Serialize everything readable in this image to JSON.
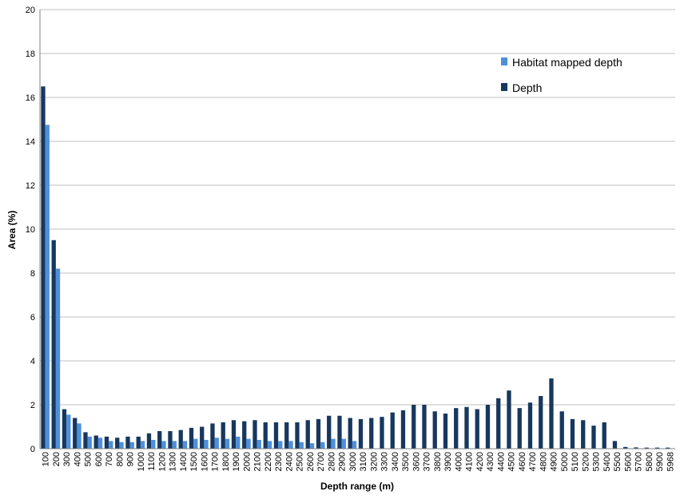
{
  "chart_data": {
    "type": "bar",
    "title": "",
    "xlabel": "Depth range (m)",
    "ylabel": "Area (%)",
    "ylim": [
      0,
      20
    ],
    "yticks": [
      0,
      2,
      4,
      6,
      8,
      10,
      12,
      14,
      16,
      18,
      20
    ],
    "grid": "horizontal",
    "legend_position": "top-right",
    "categories": [
      "100",
      "200",
      "300",
      "400",
      "500",
      "600",
      "700",
      "800",
      "900",
      "1000",
      "1100",
      "1200",
      "1300",
      "1400",
      "1500",
      "1600",
      "1700",
      "1800",
      "1900",
      "2000",
      "2100",
      "2200",
      "2300",
      "2400",
      "2500",
      "2600",
      "2700",
      "2800",
      "2900",
      "3000",
      "3100",
      "3200",
      "3300",
      "3400",
      "3500",
      "3600",
      "3700",
      "3800",
      "3900",
      "4000",
      "4100",
      "4200",
      "4300",
      "4400",
      "4500",
      "4600",
      "4700",
      "4800",
      "4900",
      "5000",
      "5100",
      "5200",
      "5300",
      "5400",
      "5500",
      "5600",
      "5700",
      "5800",
      "5900",
      "5968"
    ],
    "series": [
      {
        "name": "Depth",
        "color": "#17375e",
        "values": [
          16.5,
          9.5,
          1.8,
          1.4,
          0.75,
          0.6,
          0.55,
          0.5,
          0.55,
          0.55,
          0.7,
          0.8,
          0.8,
          0.85,
          0.95,
          1.0,
          1.15,
          1.2,
          1.3,
          1.25,
          1.3,
          1.2,
          1.2,
          1.2,
          1.2,
          1.3,
          1.35,
          1.5,
          1.5,
          1.4,
          1.35,
          1.4,
          1.45,
          1.65,
          1.75,
          2.0,
          2.0,
          1.7,
          1.6,
          1.85,
          1.9,
          1.8,
          2.0,
          2.3,
          2.65,
          1.85,
          2.1,
          2.4,
          3.2,
          1.7,
          1.35,
          1.3,
          1.05,
          1.2,
          0.35,
          0.08,
          0.06,
          0.05,
          0.05,
          0.05
        ]
      },
      {
        "name": "Habitat mapped depth",
        "color": "#4f8fd9",
        "values": [
          14.75,
          8.2,
          1.55,
          1.15,
          0.55,
          0.5,
          0.35,
          0.3,
          0.3,
          0.35,
          0.4,
          0.35,
          0.35,
          0.35,
          0.45,
          0.4,
          0.5,
          0.45,
          0.55,
          0.45,
          0.4,
          0.35,
          0.35,
          0.35,
          0.3,
          0.25,
          0.3,
          0.45,
          0.45,
          0.35,
          null,
          null,
          null,
          null,
          null,
          null,
          null,
          null,
          null,
          null,
          null,
          null,
          null,
          null,
          null,
          null,
          null,
          null,
          null,
          null,
          null,
          null,
          null,
          null,
          null,
          null,
          null,
          null,
          null,
          null
        ]
      }
    ]
  }
}
